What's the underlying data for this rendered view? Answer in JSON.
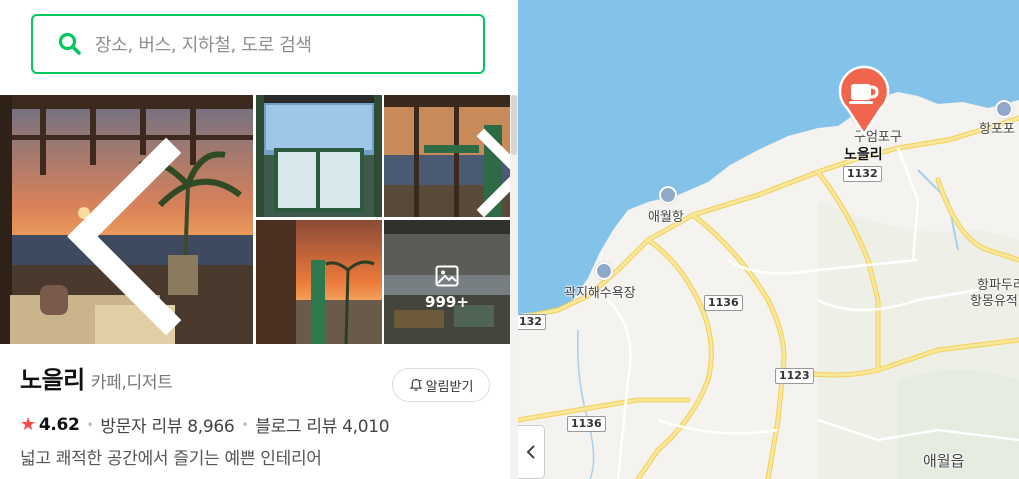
{
  "search": {
    "placeholder": "장소, 버스, 지하철, 도로 검색"
  },
  "gallery": {
    "more_count": "999+"
  },
  "place": {
    "name": "노을리",
    "category": "카페,디저트",
    "alarm_label": "알림받기",
    "rating": "4.62",
    "visitor_reviews": "방문자 리뷰 8,966",
    "blog_reviews": "블로그 리뷰 4,010",
    "description": "넓고 쾌적한 공간에서 즐기는 예쁜 인테리어"
  },
  "map": {
    "marker": {
      "label": "노을리",
      "icon": "cafe-cup-icon",
      "color": "#f0654e"
    },
    "labels": {
      "aewol_port": "애월항",
      "gwakji_beach": "곽지해수욕장",
      "hagwi_port": "구엄포구",
      "hangpo": "항포포",
      "hangpadu": "항파두리",
      "hangmong": "항몽유적",
      "aewol_eup": "애월읍"
    },
    "routes": {
      "r1132_top": "1132",
      "r1136_mid": "1136",
      "r1123": "1123",
      "r1136_low": "1136",
      "r1132_left": "132"
    }
  },
  "colors": {
    "accent": "#03c75a",
    "sea": "#84c3e9",
    "land": "#f4f3ef",
    "road": "#f9dc6e"
  }
}
